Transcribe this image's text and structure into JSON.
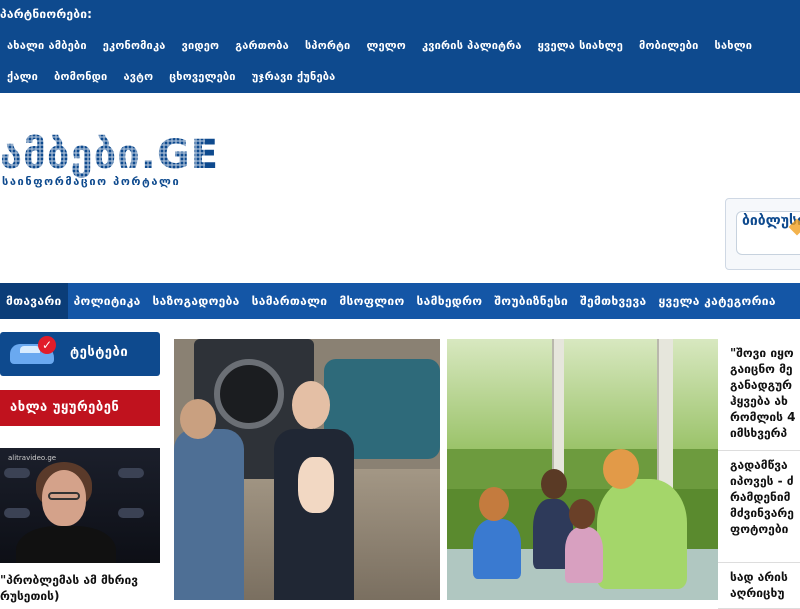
{
  "partners_label": "პარტნიორები:",
  "top_links_row1": [
    "ახალი ამბები",
    "ეკონომიკა",
    "ვიდეო",
    "გართობა",
    "სპორტი",
    "ლელო",
    "კვირის პალიტრა",
    "ყველა სიახლე",
    "მობილები",
    "სახლი"
  ],
  "top_links_row2": [
    "ქალი",
    "ბომონდი",
    "ავტო",
    "ცხოველები",
    "უჯრავი ქუნება"
  ],
  "logo": {
    "name": "ამბები.GE",
    "subtitle": "საინფორმაციო პორტალი"
  },
  "banner": {
    "label": "ბიბლუსი"
  },
  "main_nav": [
    "მთავარი",
    "პოლიტიკა",
    "საზოგადოება",
    "სამართალი",
    "მსოფლიო",
    "სამხედრო",
    "შოუბიზნესი",
    "შემთხვევა",
    "ყველა კატეგორია"
  ],
  "main_nav_active": 0,
  "tests_label": "ტესტები",
  "watch_label": "ახლა უყურებენ",
  "video": {
    "watermark": "alitravideo.ge",
    "caption": "\"პრობლემას ამ მხრივ\nრუსეთის)"
  },
  "sidebar_news": [
    {
      "text": "\"შოვი იყო\nგაიცნო მე\nგანადგურ\nჰყვება ახ\nრომლის 4\nიმსხვერპ"
    },
    {
      "text": "გადამწვა\nიპოვეს - ძ\nრამდენიმ\nმძვინვარე\nფოტოები"
    },
    {
      "text": "სად არის\nაღრიცხუ"
    }
  ],
  "colors": {
    "top_bar": "#0e4a8e",
    "main_nav": "#1456a6",
    "active_tab": "#0b3d78",
    "watch_red": "#c0121e"
  }
}
